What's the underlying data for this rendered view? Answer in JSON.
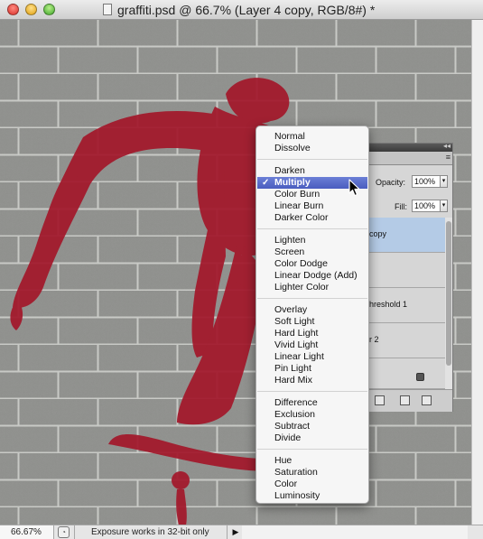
{
  "window": {
    "title": "graffiti.psd @ 66.7% (Layer 4 copy, RGB/8#) *"
  },
  "status": {
    "zoom": "66.67%",
    "message": "Exposure works in 32-bit only",
    "arrow": "▶"
  },
  "panel": {
    "opacity_label": "Opacity:",
    "opacity_value": "100%",
    "fill_label": "Fill:",
    "fill_value": "100%",
    "menu_icon": "≡",
    "collapse_icon": "◂◂",
    "layers": [
      {
        "name": "copy",
        "selected": true
      },
      {
        "name": "",
        "selected": false
      },
      {
        "name": "hreshold 1",
        "selected": false
      },
      {
        "name": "r 2",
        "selected": false
      },
      {
        "name": "",
        "selected": false
      }
    ]
  },
  "blend_menu": {
    "groups": [
      [
        {
          "label": "Normal"
        },
        {
          "label": "Dissolve"
        }
      ],
      [
        {
          "label": "Darken"
        },
        {
          "label": "Multiply",
          "checked": true
        },
        {
          "label": "Color Burn"
        },
        {
          "label": "Linear Burn"
        },
        {
          "label": "Darker Color"
        }
      ],
      [
        {
          "label": "Lighten"
        },
        {
          "label": "Screen"
        },
        {
          "label": "Color Dodge"
        },
        {
          "label": "Linear Dodge (Add)"
        },
        {
          "label": "Lighter Color"
        }
      ],
      [
        {
          "label": "Overlay"
        },
        {
          "label": "Soft Light"
        },
        {
          "label": "Hard Light"
        },
        {
          "label": "Vivid Light"
        },
        {
          "label": "Linear Light"
        },
        {
          "label": "Pin Light"
        },
        {
          "label": "Hard Mix"
        }
      ],
      [
        {
          "label": "Difference"
        },
        {
          "label": "Exclusion"
        },
        {
          "label": "Subtract"
        },
        {
          "label": "Divide"
        }
      ],
      [
        {
          "label": "Hue"
        },
        {
          "label": "Saturation"
        },
        {
          "label": "Color"
        },
        {
          "label": "Luminosity"
        }
      ]
    ],
    "check_mark": "✓"
  },
  "colors": {
    "graffiti_red": "#a3172a",
    "wall_gray": "#8e8f8c",
    "menu_highlight": "#5568c9",
    "layer_selected": "#b4cbe6"
  }
}
